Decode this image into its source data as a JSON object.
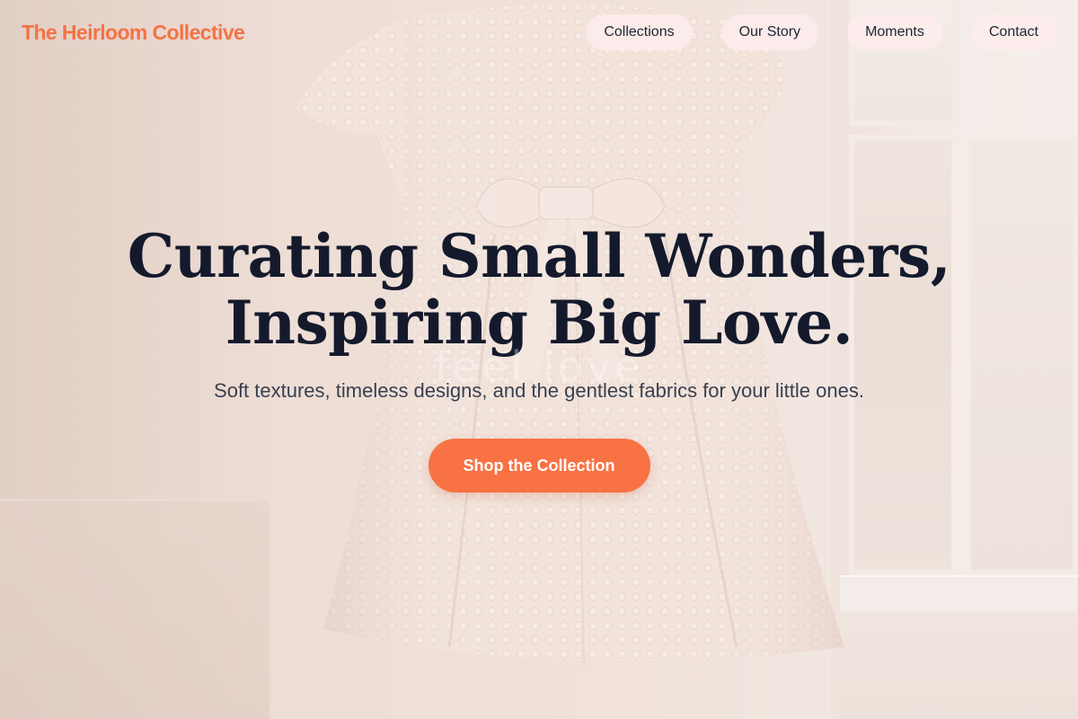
{
  "brand": {
    "name": "The Heirloom Collective",
    "accent_color": "#f47246"
  },
  "nav": {
    "items": [
      {
        "label": "Collections"
      },
      {
        "label": "Our Story"
      },
      {
        "label": "Moments"
      },
      {
        "label": "Contact"
      }
    ]
  },
  "hero": {
    "title_line_1": "Curating Small Wonders,",
    "title_line_2": "Inspiring Big Love.",
    "background_text": "feel love",
    "subtitle": "Soft textures, timeless designs, and the gentlest fabrics for your little ones.",
    "cta_label": "Shop the Collection",
    "cta_color": "#f87244",
    "title_color": "#141a2c"
  }
}
